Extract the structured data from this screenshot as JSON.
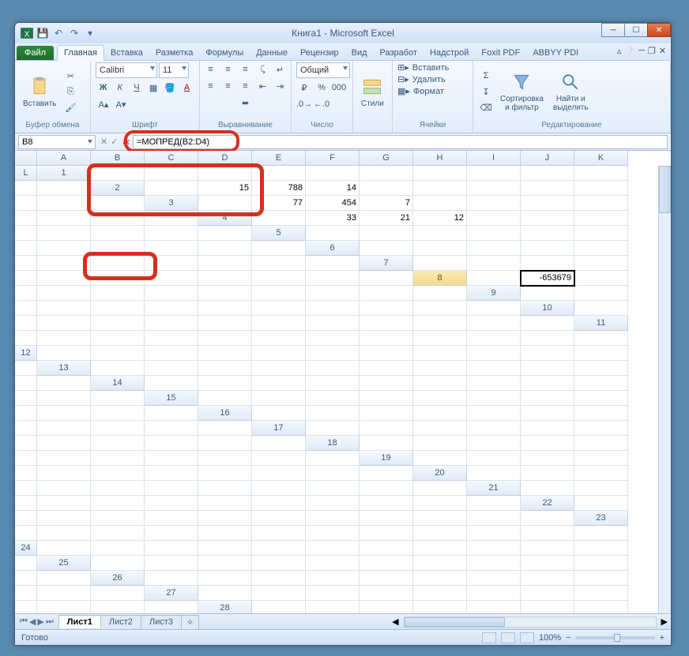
{
  "window": {
    "title": "Книга1 - Microsoft Excel"
  },
  "tabs": {
    "file": "Файл",
    "list": [
      "Главная",
      "Вставка",
      "Разметка",
      "Формулы",
      "Данные",
      "Рецензир",
      "Вид",
      "Разработ",
      "Надстрой",
      "Foxit PDF",
      "ABBYY PDI"
    ],
    "active": 0
  },
  "ribbon": {
    "clipboard": {
      "label": "Буфер обмена",
      "paste": "Вставить"
    },
    "font": {
      "label": "Шрифт",
      "name": "Calibri",
      "size": "11"
    },
    "alignment": {
      "label": "Выравнивание"
    },
    "number": {
      "label": "Число",
      "format": "Общий"
    },
    "styles": {
      "label": "Стили",
      "btn": "Стили"
    },
    "cells": {
      "label": "Ячейки",
      "insert": "Вставить",
      "delete": "Удалить",
      "format": "Формат"
    },
    "editing": {
      "label": "Редактирование",
      "sort": "Сортировка\nи фильтр",
      "find": "Найти и\nвыделить"
    }
  },
  "formula_bar": {
    "namebox": "B8",
    "formula": "=МОПРЕД(B2:D4)"
  },
  "columns": [
    "A",
    "B",
    "C",
    "D",
    "E",
    "F",
    "G",
    "H",
    "I",
    "J",
    "K",
    "L"
  ],
  "row_count": 30,
  "active_cell": {
    "row": 8,
    "col": "B",
    "display": "-653679"
  },
  "matrix": {
    "r2": {
      "B": "15",
      "C": "788",
      "D": "14"
    },
    "r3": {
      "B": "77",
      "C": "454",
      "D": "7"
    },
    "r4": {
      "B": "33",
      "C": "21",
      "D": "12"
    }
  },
  "sheets": {
    "list": [
      "Лист1",
      "Лист2",
      "Лист3"
    ],
    "active": 0
  },
  "status": {
    "ready": "Готово",
    "zoom": "100%"
  }
}
